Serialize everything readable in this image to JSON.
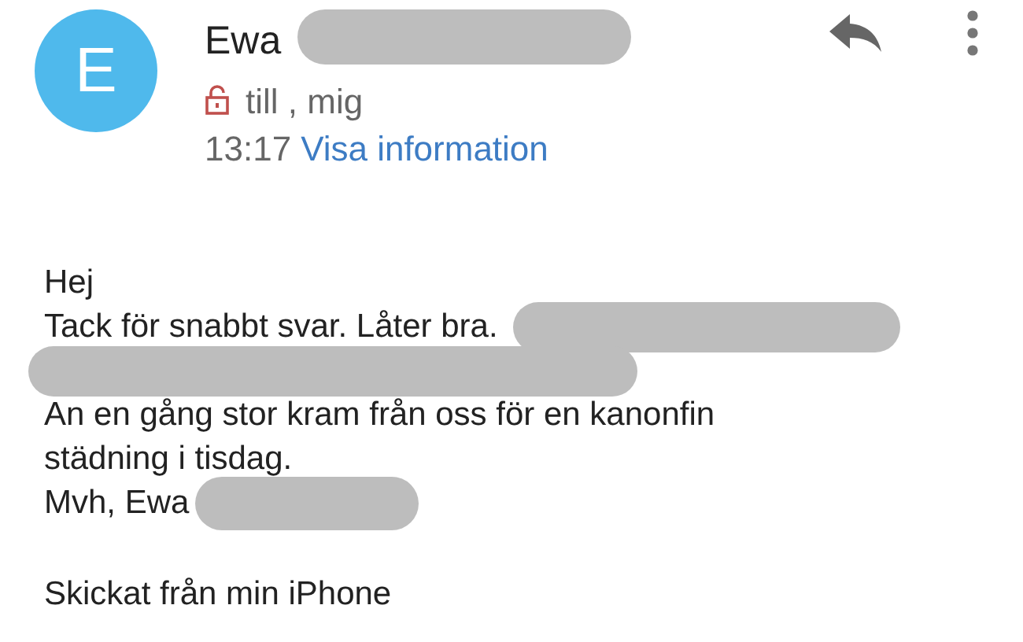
{
  "header": {
    "avatar_letter": "E",
    "sender_name": "Ewa",
    "sender_redacted": true,
    "lock_recipients": true,
    "recipients": "till , mig",
    "time": "13:17",
    "details_link": "Visa information"
  },
  "body": {
    "lines": [
      {
        "kind": "text",
        "text": "Hej",
        "redacted_after": false
      },
      {
        "kind": "text",
        "text": "Tack för snabbt svar. Låter bra.",
        "redacted_after": true
      },
      {
        "kind": "redaction"
      },
      {
        "kind": "text",
        "text": "An en gång stor kram från oss för en kanonfin",
        "redacted_after": false
      },
      {
        "kind": "text",
        "text": "städning i tisdag.",
        "redacted_after": false
      },
      {
        "kind": "text",
        "text": "Mvh, Ewa",
        "redacted_after": true
      },
      {
        "kind": "gap"
      },
      {
        "kind": "text",
        "text": "Skickat från min iPhone",
        "redacted_after": false
      }
    ]
  }
}
